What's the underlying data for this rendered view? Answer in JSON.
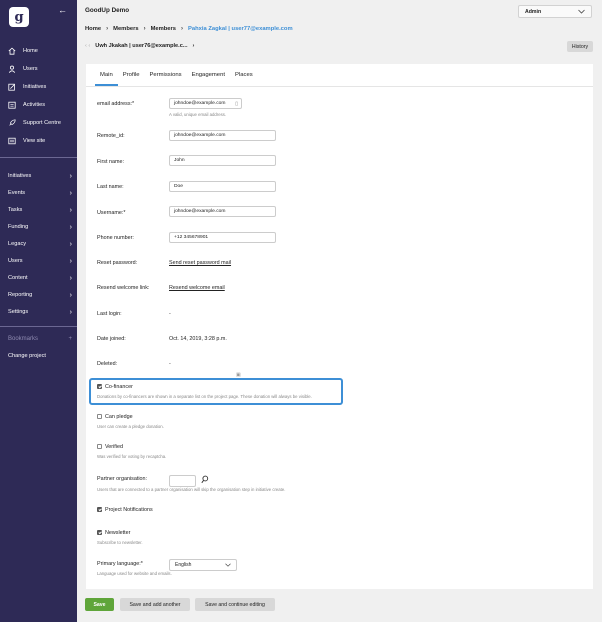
{
  "app": {
    "title": "GoodUp Demo",
    "logo_letter": "g",
    "user_menu": "Admin"
  },
  "sidebar": {
    "main_items": [
      {
        "label": "Home",
        "icon": "home-icon"
      },
      {
        "label": "Users",
        "icon": "user-icon"
      },
      {
        "label": "Initiatives",
        "icon": "pencil-icon"
      },
      {
        "label": "Activities",
        "icon": "calendar-icon"
      },
      {
        "label": "Support Centre",
        "icon": "rocket-icon"
      },
      {
        "label": "View site",
        "icon": "monitor-icon"
      }
    ],
    "sections": [
      "Initiatives",
      "Events",
      "Tasks",
      "Funding",
      "Legacy",
      "Users",
      "Content",
      "Reporting",
      "Settings"
    ],
    "bookmarks_label": "Bookmarks",
    "bookmarks_add": "+",
    "change_project": "Change project"
  },
  "breadcrumb": {
    "home": "Home",
    "members1": "Members",
    "members2": "Members",
    "current": "Pahxia Zagkal | user77@example.com"
  },
  "object_nav": {
    "prev": "‹ ‹",
    "title": "Uwh Jkakah | user76@example.c...",
    "next": "›"
  },
  "history_button": "History",
  "tabs": [
    "Main",
    "Profile",
    "Permissions",
    "Engagement",
    "Places"
  ],
  "form": {
    "email_label": "email address:*",
    "email_value": "johndoe@example.com",
    "email_help": "A valid, unique email address.",
    "remote_label": "Remote_id:",
    "remote_value": "johndoe@example.com",
    "first_name_label": "First name:",
    "first_name_value": "John",
    "last_name_label": "Last name:",
    "last_name_value": "Doe",
    "username_label": "Username:*",
    "username_value": "johndoe@example.com",
    "phone_label": "Phone number:",
    "phone_value": "+12 345678901",
    "reset_label": "Reset password:",
    "reset_link": "Send reset password mail",
    "resend_label": "Resend welcome link:",
    "resend_link": "Resend welcome email",
    "last_login_label": "Last login:",
    "last_login_value": "-",
    "date_joined_label": "Date joined:",
    "date_joined_value": "Oct. 14, 2019, 3:28 p.m.",
    "deleted_label": "Deleted:",
    "deleted_value": "-",
    "cofinancer_label": "Co-financer",
    "cofinancer_help": "Donations by co-financers are shown in a separate list on the project page. These donation will always be visible.",
    "can_pledge_label": "Can pledge",
    "can_pledge_help": "User can create a pledge donation.",
    "verified_label": "Verified",
    "verified_help": "Was verified for voting by recaptcha.",
    "partner_label": "Partner organisation:",
    "partner_help": "Users that are connected to a partner organisation will skip the organisation step in initiative create.",
    "project_notifications_label": "Project Notifications",
    "newsletter_label": "Newsletter",
    "newsletter_help": "Subscribe to newsletter.",
    "language_label": "Primary language:*",
    "language_value": "English",
    "language_help": "Language used for website and emails."
  },
  "footer": {
    "save": "Save",
    "save_add": "Save and add another",
    "save_continue": "Save and continue editing"
  }
}
